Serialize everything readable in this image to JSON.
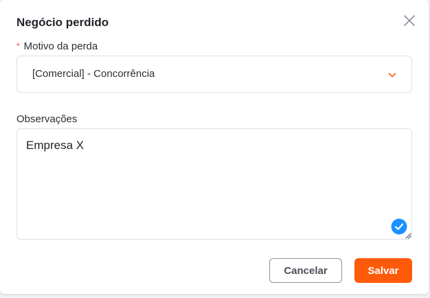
{
  "dialog": {
    "title": "Negócio perdido"
  },
  "reason_field": {
    "required_marker": "*",
    "label": "Motivo da perda",
    "selected_value": "[Comercial] - Concorrência"
  },
  "notes_field": {
    "label": "Observações",
    "value": "Empresa X"
  },
  "actions": {
    "cancel_label": "Cancelar",
    "save_label": "Salvar"
  },
  "colors": {
    "accent": "#fd5a0a",
    "required": "#e5484d",
    "check_badge": "#1e90ff"
  },
  "icons": {
    "close": "close-icon",
    "dropdown": "chevron-down-icon",
    "check": "check-circle-icon",
    "resize": "resize-handle-icon"
  }
}
